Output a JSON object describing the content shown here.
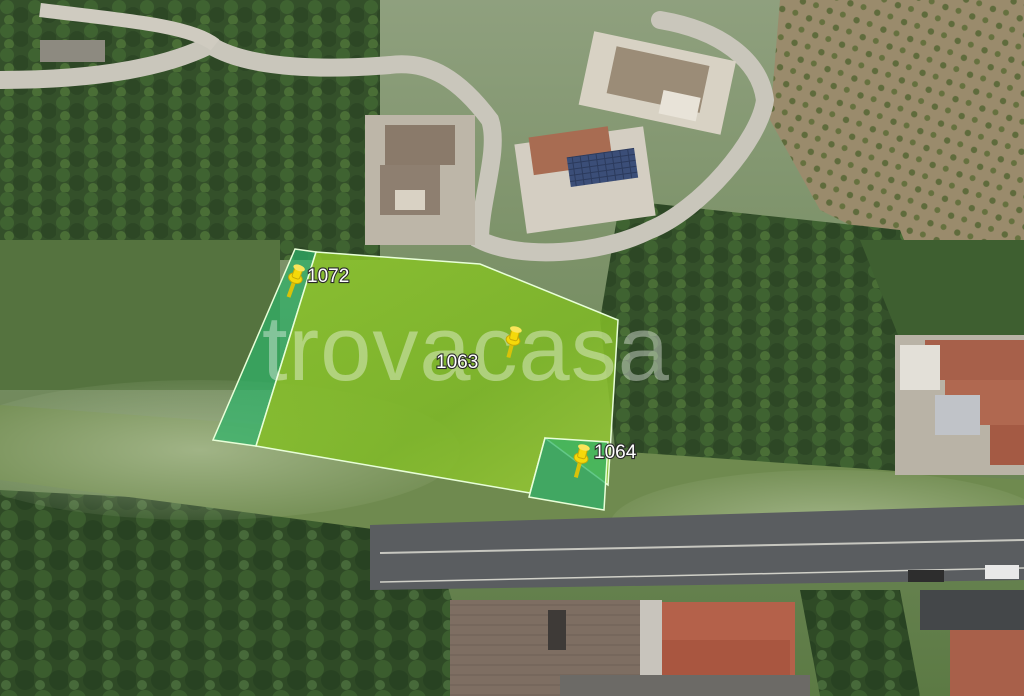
{
  "watermark": {
    "text": "trovacasa"
  },
  "parcels": [
    {
      "id": "parcel-1072",
      "label": "1072"
    },
    {
      "id": "parcel-1063",
      "label": "1063"
    },
    {
      "id": "parcel-1064",
      "label": "1064"
    }
  ],
  "colors": {
    "parcel_main": "#86c428",
    "parcel_strip": "#2fb36a",
    "parcel_outline": "#e8ffd8",
    "pin": "#f5d90a",
    "road": "#5a5d60",
    "roof_tile": "#b4614a"
  },
  "icons": [
    "pushpin-icon",
    "pushpin-icon",
    "pushpin-icon"
  ]
}
